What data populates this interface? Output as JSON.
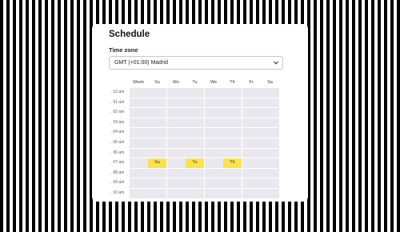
{
  "title": "Schedule",
  "timezone": {
    "label": "Time zone",
    "value": "GMT (+01:00) Madrid"
  },
  "columns": [
    "Week",
    "Su",
    "Mo",
    "Tu",
    "We",
    "Th",
    "Fr",
    "Sa"
  ],
  "hours": [
    "12 am",
    "01 am",
    "02 am",
    "03 am",
    "04 am",
    "05 am",
    "06 am",
    "07 am",
    "08 am",
    "09 am",
    "10 am"
  ],
  "selected_slots": [
    {
      "hour": "07 am",
      "day": "Su",
      "label": "Su"
    },
    {
      "hour": "07 am",
      "day": "Tu",
      "label": "Tu"
    },
    {
      "hour": "07 am",
      "day": "Th",
      "label": "Th"
    }
  ],
  "colors": {
    "slot_empty": "#e9e8ee",
    "slot_selected": "#fbe24a"
  },
  "icons": {
    "select": "chevron-down-icon",
    "hour_toggle": "chevron-right-icon"
  }
}
